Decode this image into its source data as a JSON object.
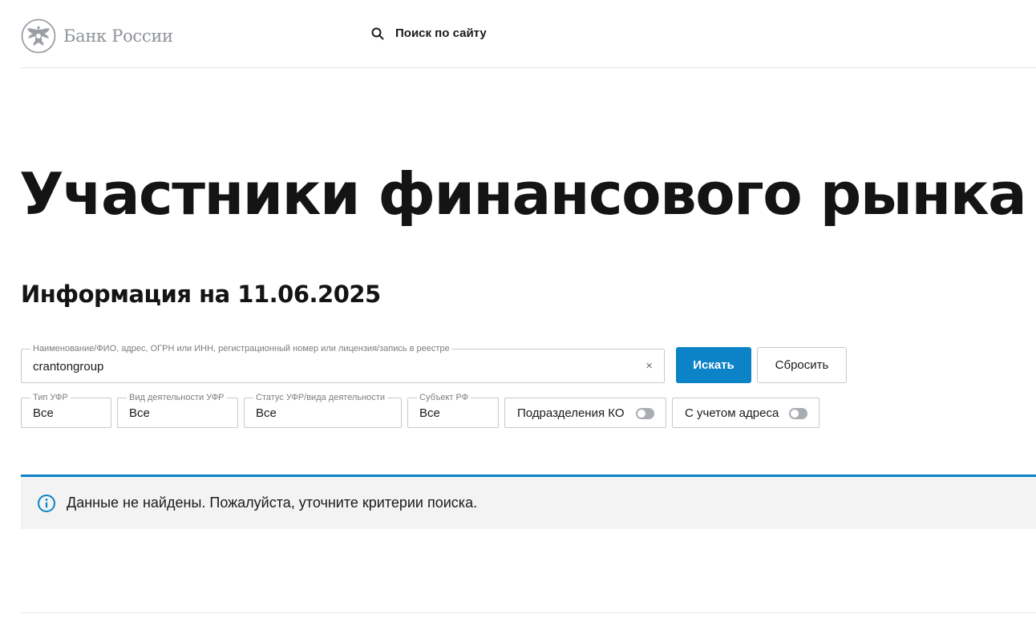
{
  "header": {
    "logo_text": "Банк России",
    "search_label": "Поиск по сайту"
  },
  "page": {
    "title": "Участники финансового рынка",
    "info_date": "Информация на 11.06.2025"
  },
  "search": {
    "legend": "Наименование/ФИО, адрес, ОГРН или ИНН, регистрационный номер или лицензия/запись в реестре",
    "value": "crantongroup",
    "clear_label": "×",
    "submit_label": "Искать",
    "reset_label": "Сбросить"
  },
  "filters": [
    {
      "legend": "Тип УФР",
      "value": "Все"
    },
    {
      "legend": "Вид деятельности УФР",
      "value": "Все"
    },
    {
      "legend": "Статус УФР/вида деятельности",
      "value": "Все"
    },
    {
      "legend": "Субъект РФ",
      "value": "Все"
    }
  ],
  "toggles": [
    {
      "label": "Подразделения КО",
      "checked": false
    },
    {
      "label": "С учетом адреса",
      "checked": false
    }
  ],
  "notice": {
    "icon": "info-icon",
    "text": "Данные не найдены. Пожалуйста, уточните критерии поиска."
  },
  "colors": {
    "accent": "#0d83c7",
    "notice_bg": "#f3f3f3",
    "muted_text": "#8f9399"
  }
}
